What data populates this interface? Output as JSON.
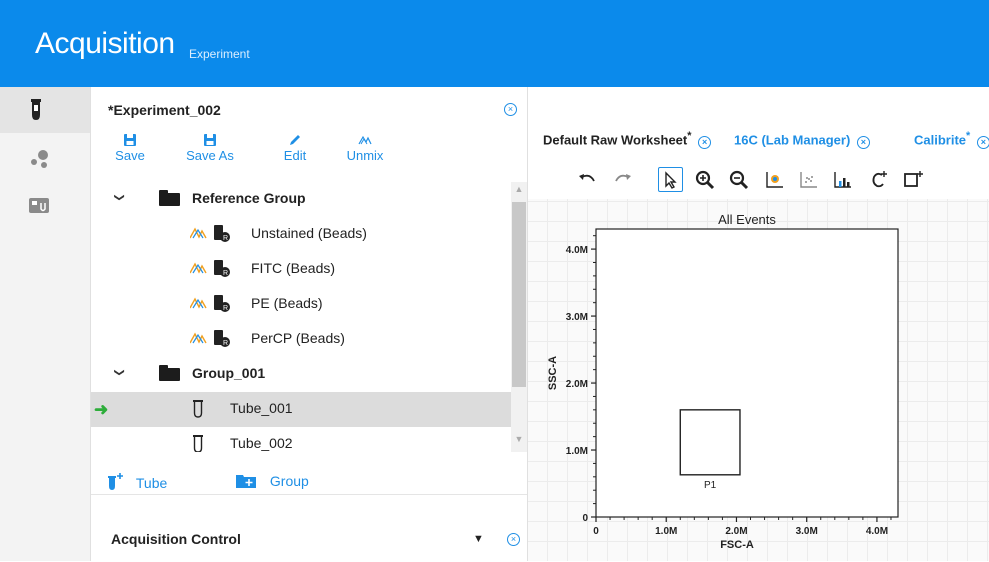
{
  "header": {
    "title": "Acquisition",
    "subtitle": "Experiment"
  },
  "experiment": {
    "title": "*Experiment_002",
    "toolbar": {
      "save": "Save",
      "save_as": "Save As",
      "edit": "Edit",
      "unmix": "Unmix"
    },
    "tree": [
      {
        "type": "group",
        "label": "Reference Group"
      },
      {
        "type": "ref",
        "label": "Unstained (Beads)"
      },
      {
        "type": "ref",
        "label": "FITC (Beads)"
      },
      {
        "type": "ref",
        "label": "PE (Beads)"
      },
      {
        "type": "ref",
        "label": "PerCP (Beads)"
      },
      {
        "type": "group",
        "label": "Group_001"
      },
      {
        "type": "tube",
        "label": "Tube_001",
        "selected": true
      },
      {
        "type": "tube",
        "label": "Tube_002"
      }
    ],
    "add_tube": "Tube",
    "add_group": "Group",
    "acquisition_control": "Acquisition Control"
  },
  "worksheet": {
    "tabs": [
      {
        "label": "Default Raw Worksheet",
        "modified_mark": "*"
      },
      {
        "label": "16C (Lab Manager)",
        "modified_mark": ""
      },
      {
        "label": "Calibrite",
        "modified_mark": "*"
      }
    ],
    "tools": [
      "undo-icon",
      "redo-icon",
      "pointer-icon",
      "zoom-in-icon",
      "zoom-out-icon",
      "dot-plot-icon",
      "density-plot-icon",
      "histogram-icon",
      "gate-add-icon",
      "rectangle-gate-icon"
    ]
  },
  "plot": {
    "title": "All Events",
    "xlabel": "FSC-A",
    "ylabel": "SSC-A",
    "x_ticks": [
      "0",
      "1.0M",
      "2.0M",
      "3.0M",
      "4.0M"
    ],
    "y_ticks": [
      "1.0M",
      "2.0M",
      "3.0M",
      "4.0M"
    ],
    "y_zero": "0",
    "gate": {
      "label": "P1",
      "x_min": 1.2,
      "x_max": 2.05,
      "y_min": 0.63,
      "y_max": 1.6
    }
  },
  "colors": {
    "header": "#0b8aeb",
    "accent": "#1f8fe5",
    "arrow": "#2dad3a"
  }
}
